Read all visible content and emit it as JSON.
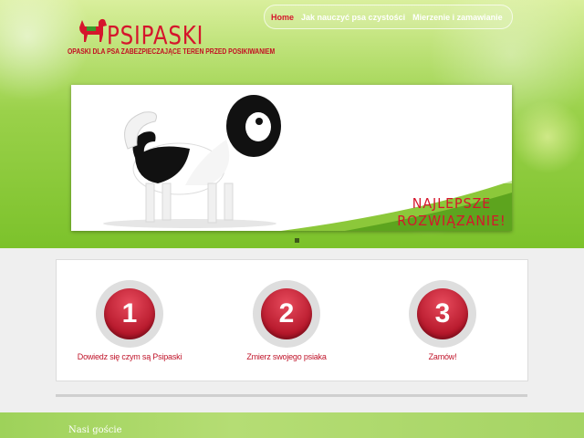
{
  "brand": {
    "logo_text": "PSIPASKI",
    "tagline": "OPASKI DLA PSA  ZABEZPIECZAJĄCE TEREN PRZED POSIKIWANIEM"
  },
  "nav": {
    "items": [
      {
        "label": "Home",
        "active": true
      },
      {
        "label": "Jak nauczyć psa czystości",
        "active": false
      },
      {
        "label": "Mierzenie i zamawianie",
        "active": false
      }
    ]
  },
  "slider": {
    "caption_line1": "NAJLEPSZE",
    "caption_line2": "ROZWIĄZANIE!",
    "prev_glyph": "‹",
    "next_glyph": "›"
  },
  "steps": [
    {
      "number": "1",
      "label": "Dowiedz się czym są Psipaski"
    },
    {
      "number": "2",
      "label": "Zmierz swojego psiaka"
    },
    {
      "number": "3",
      "label": "Zamów!"
    }
  ],
  "footer": {
    "section_title": "Nasi goście"
  },
  "colors": {
    "brand_red": "#d5162c",
    "hero_green": "#8ccb3c"
  }
}
